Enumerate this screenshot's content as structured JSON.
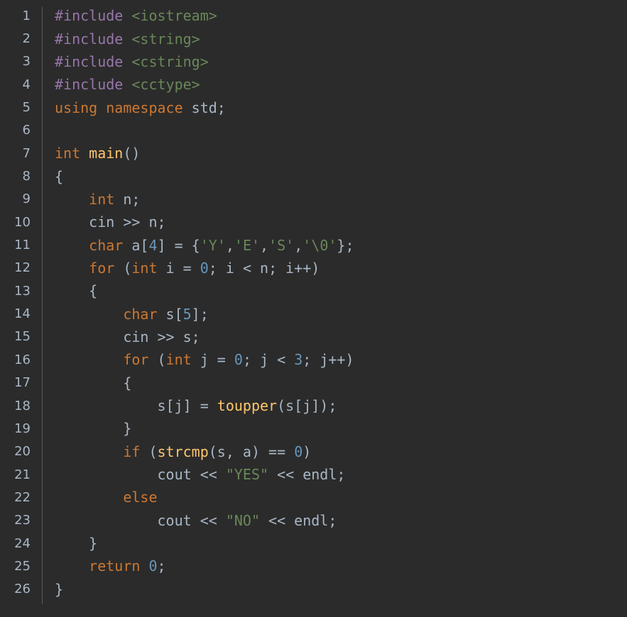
{
  "editor": {
    "lines": [
      {
        "n": "1",
        "tokens": [
          [
            "pp",
            "#include"
          ],
          [
            "plain",
            " "
          ],
          [
            "inc",
            "<iostream>"
          ]
        ]
      },
      {
        "n": "2",
        "tokens": [
          [
            "pp",
            "#include"
          ],
          [
            "plain",
            " "
          ],
          [
            "inc",
            "<string>"
          ]
        ]
      },
      {
        "n": "3",
        "tokens": [
          [
            "pp",
            "#include"
          ],
          [
            "plain",
            " "
          ],
          [
            "inc",
            "<cstring>"
          ]
        ]
      },
      {
        "n": "4",
        "tokens": [
          [
            "pp",
            "#include"
          ],
          [
            "plain",
            " "
          ],
          [
            "inc",
            "<cctype>"
          ]
        ]
      },
      {
        "n": "5",
        "tokens": [
          [
            "kw",
            "using"
          ],
          [
            "plain",
            " "
          ],
          [
            "kw",
            "namespace"
          ],
          [
            "plain",
            " std;"
          ]
        ]
      },
      {
        "n": "6",
        "tokens": []
      },
      {
        "n": "7",
        "tokens": [
          [
            "kw",
            "int"
          ],
          [
            "plain",
            " "
          ],
          [
            "fn",
            "main"
          ],
          [
            "plain",
            "()"
          ]
        ]
      },
      {
        "n": "8",
        "tokens": [
          [
            "plain",
            "{"
          ]
        ]
      },
      {
        "n": "9",
        "tokens": [
          [
            "plain",
            "    "
          ],
          [
            "kw",
            "int"
          ],
          [
            "plain",
            " n;"
          ]
        ]
      },
      {
        "n": "10",
        "tokens": [
          [
            "plain",
            "    cin >> n;"
          ]
        ]
      },
      {
        "n": "11",
        "tokens": [
          [
            "plain",
            "    "
          ],
          [
            "kw",
            "char"
          ],
          [
            "plain",
            " a["
          ],
          [
            "num",
            "4"
          ],
          [
            "plain",
            "] = {"
          ],
          [
            "str",
            "'Y'"
          ],
          [
            "plain",
            ","
          ],
          [
            "str",
            "'E'"
          ],
          [
            "plain",
            ","
          ],
          [
            "str",
            "'S'"
          ],
          [
            "plain",
            ","
          ],
          [
            "str",
            "'\\0'"
          ],
          [
            "plain",
            "};"
          ]
        ]
      },
      {
        "n": "12",
        "tokens": [
          [
            "plain",
            "    "
          ],
          [
            "kw",
            "for"
          ],
          [
            "plain",
            " ("
          ],
          [
            "kw",
            "int"
          ],
          [
            "plain",
            " i = "
          ],
          [
            "num",
            "0"
          ],
          [
            "plain",
            "; i < n; i++)"
          ]
        ]
      },
      {
        "n": "13",
        "tokens": [
          [
            "plain",
            "    {"
          ]
        ]
      },
      {
        "n": "14",
        "tokens": [
          [
            "plain",
            "        "
          ],
          [
            "kw",
            "char"
          ],
          [
            "plain",
            " s["
          ],
          [
            "num",
            "5"
          ],
          [
            "plain",
            "];"
          ]
        ]
      },
      {
        "n": "15",
        "tokens": [
          [
            "plain",
            "        cin >> s;"
          ]
        ]
      },
      {
        "n": "16",
        "tokens": [
          [
            "plain",
            "        "
          ],
          [
            "kw",
            "for"
          ],
          [
            "plain",
            " ("
          ],
          [
            "kw",
            "int"
          ],
          [
            "plain",
            " j = "
          ],
          [
            "num",
            "0"
          ],
          [
            "plain",
            "; j < "
          ],
          [
            "num",
            "3"
          ],
          [
            "plain",
            "; j++)"
          ]
        ]
      },
      {
        "n": "17",
        "tokens": [
          [
            "plain",
            "        {"
          ]
        ]
      },
      {
        "n": "18",
        "tokens": [
          [
            "plain",
            "            s[j] = "
          ],
          [
            "fn",
            "toupper"
          ],
          [
            "plain",
            "(s[j]);"
          ]
        ]
      },
      {
        "n": "19",
        "tokens": [
          [
            "plain",
            "        }"
          ]
        ]
      },
      {
        "n": "20",
        "tokens": [
          [
            "plain",
            "        "
          ],
          [
            "kw",
            "if"
          ],
          [
            "plain",
            " ("
          ],
          [
            "fn",
            "strcmp"
          ],
          [
            "plain",
            "(s, a) == "
          ],
          [
            "num",
            "0"
          ],
          [
            "plain",
            ")"
          ]
        ]
      },
      {
        "n": "21",
        "tokens": [
          [
            "plain",
            "            cout << "
          ],
          [
            "str",
            "\"YES\""
          ],
          [
            "plain",
            " << endl;"
          ]
        ]
      },
      {
        "n": "22",
        "tokens": [
          [
            "plain",
            "        "
          ],
          [
            "kw",
            "else"
          ]
        ]
      },
      {
        "n": "23",
        "tokens": [
          [
            "plain",
            "            cout << "
          ],
          [
            "str",
            "\"NO\""
          ],
          [
            "plain",
            " << endl;"
          ]
        ]
      },
      {
        "n": "24",
        "tokens": [
          [
            "plain",
            "    }"
          ]
        ]
      },
      {
        "n": "25",
        "tokens": [
          [
            "plain",
            "    "
          ],
          [
            "kw",
            "return"
          ],
          [
            "plain",
            " "
          ],
          [
            "num",
            "0"
          ],
          [
            "plain",
            ";"
          ]
        ]
      },
      {
        "n": "26",
        "tokens": [
          [
            "plain",
            "}"
          ]
        ]
      }
    ]
  }
}
